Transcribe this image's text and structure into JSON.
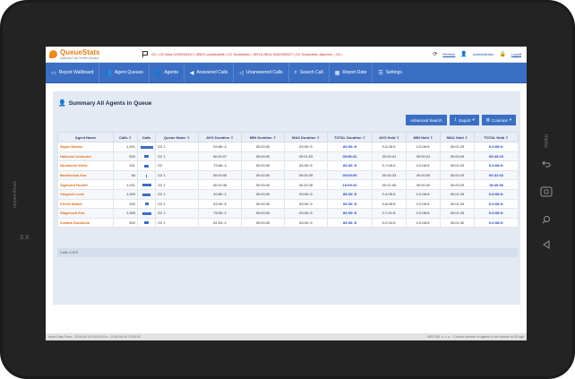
{
  "app": {
    "logo_title": "QueueStats",
    "logo_subtitle": "Asterisk Call Centre Monitor",
    "queues_text": "O2 | O2 linka 0220930310 | 3BDX podnikatelé | O2 Svoladeko | INFOLINKA 0940490327 | O2 Svoladeko dispecer | O2 |",
    "refresh_label": "Refresh",
    "user_label": "Administrator",
    "logout_label": "Logoff"
  },
  "nav": [
    {
      "label": "Report Wallboard",
      "icon": "monitor-icon"
    },
    {
      "label": "Agent Queues",
      "icon": "users-icon"
    },
    {
      "label": "Agents",
      "icon": "agent-icon"
    },
    {
      "label": "Answered Calls",
      "icon": "phone-answered-icon"
    },
    {
      "label": "Unanswered Calls",
      "icon": "phone-missed-icon"
    },
    {
      "label": "Search Call",
      "icon": "search-icon"
    },
    {
      "label": "Report Date",
      "icon": "calendar-icon"
    },
    {
      "label": "Settings",
      "icon": "sliders-icon"
    }
  ],
  "panel": {
    "title": "Summary All Agents in Queue",
    "advanced_search": "Advanced Search",
    "export": "Export",
    "columns": "Columns"
  },
  "table": {
    "headers": [
      "Agent Name",
      "Calls",
      "Calls",
      "Queue Name",
      "AVG Duration",
      "MIN Duration",
      "MAX Duration",
      "TOTAL Duration",
      "AVG Hold",
      "MIN Hold",
      "MAX Hold",
      "TOTAL Hold"
    ],
    "rows": [
      {
        "agent": "Bojan Marián",
        "calls": "1,491",
        "bar": 1.0,
        "queue": "O2 1",
        "avg_dur": "54:80::4",
        "min_dur": "00:00:00",
        "max_dur": "83:00::5",
        "total_dur": "83:00::5",
        "avg_hold": "0-5:06:0:",
        "min_hold": "0-0:08:9:",
        "max_hold": "00:01:29",
        "total_hold": "0-0:08:9:"
      },
      {
        "agent": "Halková Ľubomíra",
        "calls": "500",
        "bar": 0.34,
        "queue": "O2 1",
        "avg_dur": "00:00:07",
        "min_dur": "00:00:00",
        "max_dur": "00:01:53",
        "total_dur": "00:56:31",
        "avg_hold": "00:00:41",
        "min_hold": "00:00:01",
        "max_hold": "00:00:09",
        "total_hold": "05:43:19"
      },
      {
        "agent": "Nováková Silvia",
        "calls": "511",
        "bar": 0.34,
        "queue": "O2",
        "avg_dur": "79:60::4",
        "min_dur": "00:00:00",
        "max_dur": "83:00::5",
        "total_dur": "83:00::5",
        "avg_hold": "0-7:06:0:",
        "min_hold": "0-0:08:9:",
        "max_hold": "00:01:29",
        "total_hold": "0-0:08:9:"
      },
      {
        "agent": "Bočkovská Eva",
        "calls": "56",
        "bar": 0.04,
        "queue": "O2 1",
        "avg_dur": "00:00:05",
        "min_dur": "00:00:00",
        "max_dur": "00:00:39",
        "total_dur": "00:05:05",
        "avg_hold": "00:00:33",
        "min_hold": "00:00:00",
        "max_hold": "00:00:19",
        "total_hold": "00:31:02"
      },
      {
        "agent": "Žigmund Rudolf",
        "calls": "1,021",
        "bar": 0.68,
        "queue": "O2 1",
        "avg_dur": "00:00:36",
        "min_dur": "00:00:00",
        "max_dur": "00:20:28",
        "total_dur": "10:09:10",
        "avg_hold": "00:01:06",
        "min_hold": "00:00:00",
        "max_hold": "00:00:29",
        "total_hold": "18:40:06"
      },
      {
        "agent": "Vargová Lucie",
        "calls": "1,005",
        "bar": 0.67,
        "queue": "O2 1",
        "avg_dur": "40:80::2",
        "min_dur": "00:00:00",
        "max_dur": "83:00::5",
        "total_dur": "83:00::5",
        "avg_hold": "0-4:05:3:",
        "min_hold": "0-0:08:9:",
        "max_hold": "00:01:29",
        "total_hold": "0-0:08:9:"
      },
      {
        "agent": "Kinčík Matúš",
        "calls": "420",
        "bar": 0.28,
        "queue": "O2 1",
        "avg_dur": "83:00::5",
        "min_dur": "00:00:00",
        "max_dur": "83:00::5",
        "total_dur": "83:00::5",
        "avg_hold": "0-8:08:9:",
        "min_hold": "0-0:08:9:",
        "max_hold": "00:01:29",
        "total_hold": "0-0:08:9:"
      },
      {
        "agent": "Slagerová Eva",
        "calls": "1,069",
        "bar": 0.72,
        "queue": "O2 1",
        "avg_dur": "76:00::2",
        "min_dur": "00:00:00",
        "max_dur": "83:00::5",
        "total_dur": "83:00::5",
        "avg_hold": "0-7:01:5:",
        "min_hold": "0-0:08:9:",
        "max_hold": "00:01:29",
        "total_hold": "0-0:08:9:"
      },
      {
        "agent": "Zuzana Dudíková",
        "calls": "500",
        "bar": 0.34,
        "queue": "O2 1",
        "avg_dur": "81:00::2",
        "min_dur": "00:00:00",
        "max_dur": "83:00::5",
        "total_dur": "83:00::5",
        "avg_hold": "0-0:04:3:",
        "min_hold": "0-0:08:9:",
        "max_hold": "00:01:30",
        "total_hold": "0-0:08:9:"
      }
    ],
    "footer": "Calls: 6,573"
  },
  "status": {
    "left": "eport Date From : 2016-06-15 00:00:00 to : 2016-06-15 23:00:00",
    "right": "MEEJSK, s. r. o. - Current number of agents in the license is 50 Age"
  },
  "device": {
    "brand_vertical": "mapeenthosk",
    "brand_num": "3.X",
    "menu_label": "menu"
  }
}
